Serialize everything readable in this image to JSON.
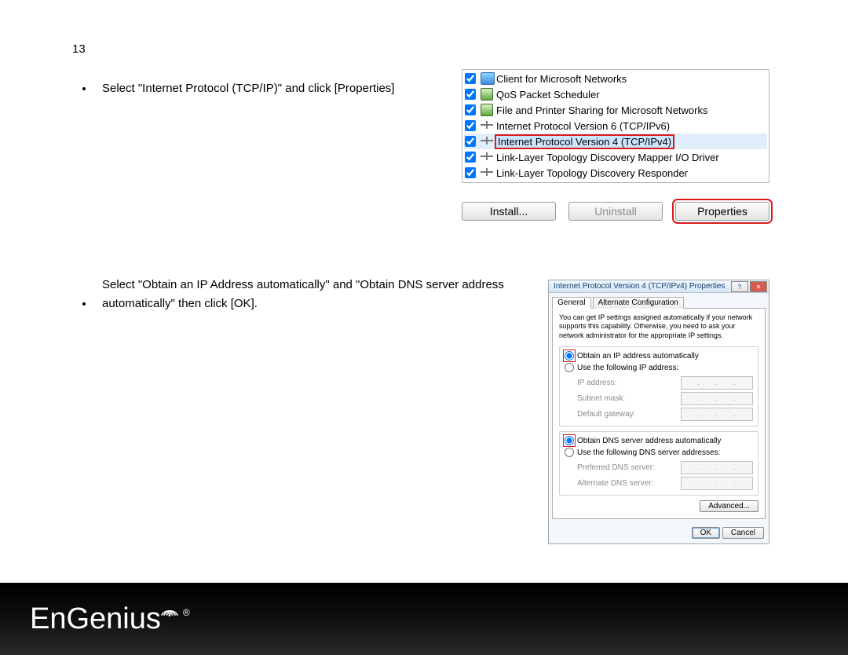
{
  "page_number": "13",
  "bullets": [
    "Select \"Internet Protocol (TCP/IP)\" and click [Properties]",
    "Select \"Obtain an IP Address automatically\" and \"Obtain DNS server address automatically\" then click [OK]."
  ],
  "netlist": {
    "items": [
      {
        "label": "Client for Microsoft Networks",
        "checked": true,
        "icon": "ic-comp"
      },
      {
        "label": "QoS Packet Scheduler",
        "checked": true,
        "icon": "ic-serv"
      },
      {
        "label": "File and Printer Sharing for Microsoft Networks",
        "checked": true,
        "icon": "ic-serv"
      },
      {
        "label": "Internet Protocol Version 6 (TCP/IPv6)",
        "checked": true,
        "icon": "ic-proto"
      },
      {
        "label": "Internet Protocol Version 4 (TCP/IPv4)",
        "checked": true,
        "icon": "ic-proto",
        "selected": true
      },
      {
        "label": "Link-Layer Topology Discovery Mapper I/O Driver",
        "checked": true,
        "icon": "ic-proto"
      },
      {
        "label": "Link-Layer Topology Discovery Responder",
        "checked": true,
        "icon": "ic-proto"
      }
    ],
    "buttons": {
      "install": "Install...",
      "uninstall": "Uninstall",
      "properties": "Properties"
    }
  },
  "dlg": {
    "title": "Internet Protocol Version 4 (TCP/IPv4) Properties",
    "tabs": {
      "general": "General",
      "altcfg": "Alternate Configuration"
    },
    "blurb": "You can get IP settings assigned automatically if your network supports this capability. Otherwise, you need to ask your network administrator for the appropriate IP settings.",
    "ip": {
      "auto": "Obtain an IP address automatically",
      "manual": "Use the following IP address:",
      "ip_label": "IP address:",
      "mask_label": "Subnet mask:",
      "gw_label": "Default gateway:"
    },
    "dns": {
      "auto": "Obtain DNS server address automatically",
      "manual": "Use the following DNS server addresses:",
      "pref": "Preferred DNS server:",
      "alt": "Alternate DNS server:"
    },
    "advanced": "Advanced...",
    "ok": "OK",
    "cancel": "Cancel"
  },
  "footer": {
    "brand": "EnGenius"
  }
}
